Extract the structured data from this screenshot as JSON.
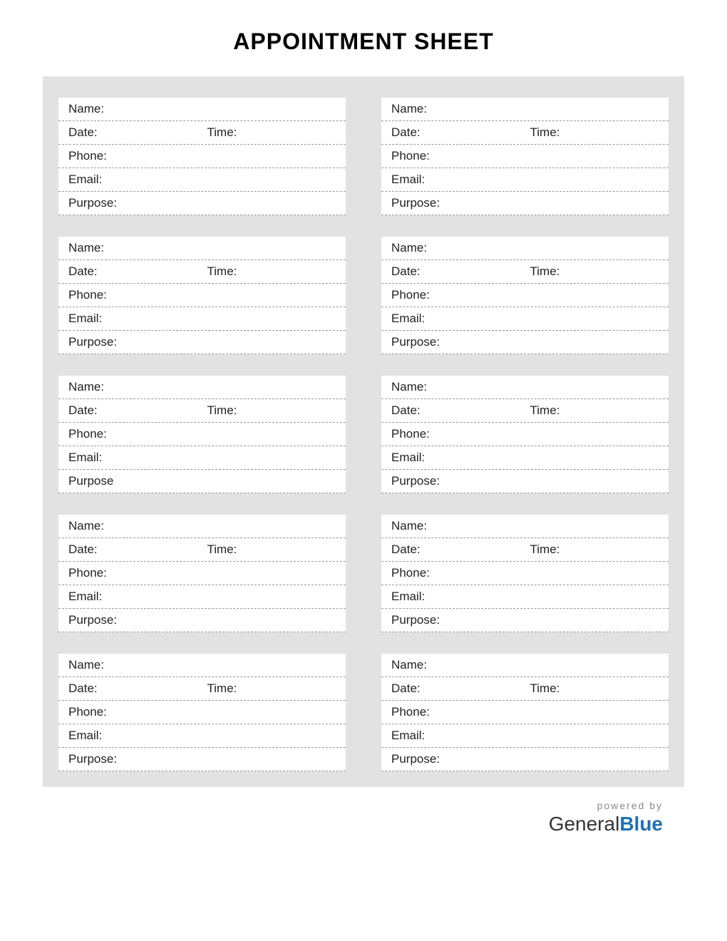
{
  "title": "APPOINTMENT SHEET",
  "labels": {
    "name": "Name:",
    "date": "Date:",
    "time": "Time:",
    "phone": "Phone:",
    "email": "Email:",
    "purpose": "Purpose:",
    "purpose_nocolon": "Purpose"
  },
  "cards": [
    {
      "purposeKey": "purpose"
    },
    {
      "purposeKey": "purpose"
    },
    {
      "purposeKey": "purpose"
    },
    {
      "purposeKey": "purpose"
    },
    {
      "purposeKey": "purpose_nocolon"
    },
    {
      "purposeKey": "purpose"
    },
    {
      "purposeKey": "purpose"
    },
    {
      "purposeKey": "purpose"
    },
    {
      "purposeKey": "purpose"
    },
    {
      "purposeKey": "purpose"
    }
  ],
  "credit": {
    "powered": "powered by",
    "brand1": "General",
    "brand2": "Blue"
  }
}
